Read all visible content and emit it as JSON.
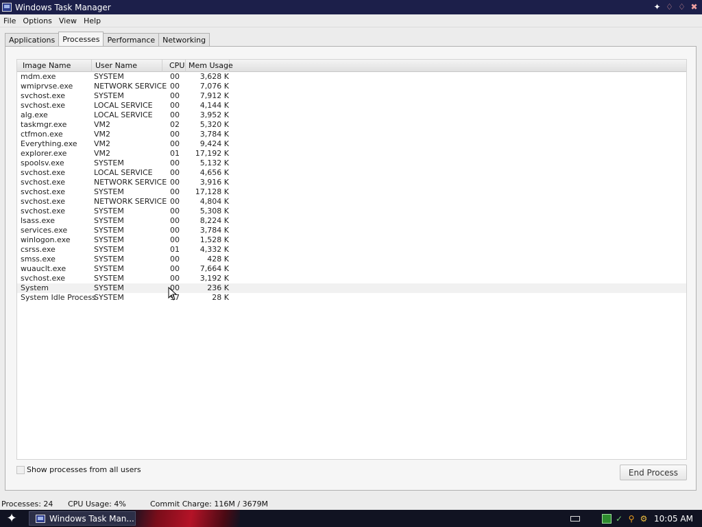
{
  "window": {
    "title": "Windows Task Manager",
    "buttons": [
      "star-icon",
      "minimize-icon",
      "maximize-icon",
      "close-icon"
    ]
  },
  "menu": [
    "File",
    "Options",
    "View",
    "Help"
  ],
  "tabs": [
    {
      "label": "Applications",
      "active": false
    },
    {
      "label": "Processes",
      "active": true
    },
    {
      "label": "Performance",
      "active": false
    },
    {
      "label": "Networking",
      "active": false
    }
  ],
  "columns": [
    "Image Name",
    "User Name",
    "CPU",
    "Mem Usage"
  ],
  "processes": [
    {
      "image": "mdm.exe",
      "user": "SYSTEM",
      "cpu": "00",
      "mem": "3,628 K"
    },
    {
      "image": "wmiprvse.exe",
      "user": "NETWORK SERVICE",
      "cpu": "00",
      "mem": "7,076 K"
    },
    {
      "image": "svchost.exe",
      "user": "SYSTEM",
      "cpu": "00",
      "mem": "7,912 K"
    },
    {
      "image": "svchost.exe",
      "user": "LOCAL SERVICE",
      "cpu": "00",
      "mem": "4,144 K"
    },
    {
      "image": "alg.exe",
      "user": "LOCAL SERVICE",
      "cpu": "00",
      "mem": "3,952 K"
    },
    {
      "image": "taskmgr.exe",
      "user": "VM2",
      "cpu": "02",
      "mem": "5,320 K"
    },
    {
      "image": "ctfmon.exe",
      "user": "VM2",
      "cpu": "00",
      "mem": "3,784 K"
    },
    {
      "image": "Everything.exe",
      "user": "VM2",
      "cpu": "00",
      "mem": "9,424 K"
    },
    {
      "image": "explorer.exe",
      "user": "VM2",
      "cpu": "01",
      "mem": "17,192 K"
    },
    {
      "image": "spoolsv.exe",
      "user": "SYSTEM",
      "cpu": "00",
      "mem": "5,132 K"
    },
    {
      "image": "svchost.exe",
      "user": "LOCAL SERVICE",
      "cpu": "00",
      "mem": "4,656 K"
    },
    {
      "image": "svchost.exe",
      "user": "NETWORK SERVICE",
      "cpu": "00",
      "mem": "3,916 K"
    },
    {
      "image": "svchost.exe",
      "user": "SYSTEM",
      "cpu": "00",
      "mem": "17,128 K"
    },
    {
      "image": "svchost.exe",
      "user": "NETWORK SERVICE",
      "cpu": "00",
      "mem": "4,804 K"
    },
    {
      "image": "svchost.exe",
      "user": "SYSTEM",
      "cpu": "00",
      "mem": "5,308 K"
    },
    {
      "image": "lsass.exe",
      "user": "SYSTEM",
      "cpu": "00",
      "mem": "8,224 K"
    },
    {
      "image": "services.exe",
      "user": "SYSTEM",
      "cpu": "00",
      "mem": "3,784 K"
    },
    {
      "image": "winlogon.exe",
      "user": "SYSTEM",
      "cpu": "00",
      "mem": "1,528 K"
    },
    {
      "image": "csrss.exe",
      "user": "SYSTEM",
      "cpu": "01",
      "mem": "4,332 K"
    },
    {
      "image": "smss.exe",
      "user": "SYSTEM",
      "cpu": "00",
      "mem": "428 K"
    },
    {
      "image": "wuauclt.exe",
      "user": "SYSTEM",
      "cpu": "00",
      "mem": "7,664 K"
    },
    {
      "image": "svchost.exe",
      "user": "SYSTEM",
      "cpu": "00",
      "mem": "3,192 K"
    },
    {
      "image": "System",
      "user": "SYSTEM",
      "cpu": "00",
      "mem": "236 K"
    },
    {
      "image": "System Idle Process",
      "user": "SYSTEM",
      "cpu": "97",
      "mem": "28 K"
    }
  ],
  "show_all_users": {
    "label": "Show processes from all users",
    "checked": false
  },
  "end_process_label": "End Process",
  "status": {
    "processes": "Processes: 24",
    "cpu": "CPU Usage: 4%",
    "commit": "Commit Charge: 116M / 3679M"
  },
  "taskbar": {
    "start_icon": "star-icon",
    "task_label": "Windows Task Man...",
    "clock": "10:05 AM"
  }
}
